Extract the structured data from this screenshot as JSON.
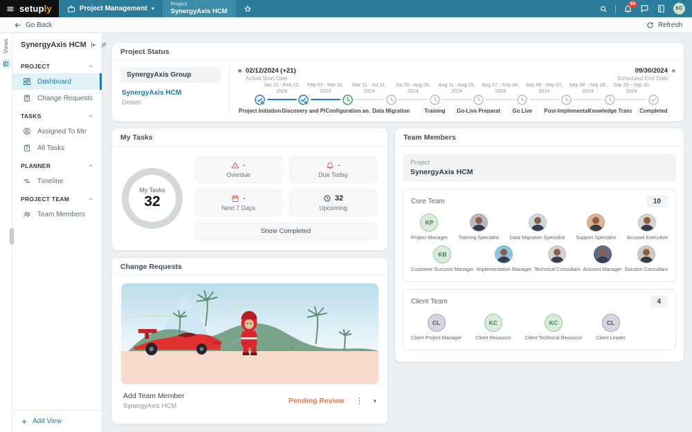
{
  "colors": {
    "topbar": "#2b7d9b",
    "accent_teal": "#1b7a9e",
    "done_blue": "#1873cc",
    "active_green": "#3da04a",
    "alert_red": "#d9534f",
    "pending_orange": "#d97c4e",
    "logo_accent": "#f0a23c",
    "badge_red": "#e2483d"
  },
  "topbar": {
    "logo_first": "setup",
    "logo_second": "ly",
    "menu": "Project Management",
    "tab_type": "Project",
    "tab_name": "SynergyAxis HCM",
    "notification_count": "64",
    "user_initials": "KC"
  },
  "toolbar": {
    "back": "Go Back",
    "refresh": "Refresh"
  },
  "views_rail": {
    "label": "Views"
  },
  "sidebar": {
    "title": "SynergyAxis HCM",
    "add_view": "Add View",
    "sections": [
      {
        "label": "PROJECT",
        "items": [
          {
            "label": "Dashboard",
            "icon": "dashboard-grid",
            "active": true
          },
          {
            "label": "Change Requests",
            "icon": "change-request-clipboard",
            "active": false
          }
        ]
      },
      {
        "label": "TASKS",
        "items": [
          {
            "label": "Assigned To Me",
            "icon": "user-circle",
            "active": false
          },
          {
            "label": "All Tasks",
            "icon": "task-clipboard",
            "active": false
          }
        ]
      },
      {
        "label": "PLANNER",
        "items": [
          {
            "label": "Timeline",
            "icon": "timeline-bars",
            "active": false
          }
        ]
      },
      {
        "label": "PROJECT TEAM",
        "items": [
          {
            "label": "Team Members",
            "icon": "people",
            "active": false
          }
        ]
      }
    ]
  },
  "project_status": {
    "title": "Project Status",
    "group": "SynergyAxis Group",
    "project": "SynergyAxis HCM",
    "details": "Details",
    "actual_start": {
      "date": "02/12/2024 (+21)",
      "label": "Actual Start Date"
    },
    "scheduled_end": {
      "date": "09/30/2024",
      "label": "Scheduled End Date"
    },
    "phases": [
      {
        "dates": "Jan 22 - Feb 12, 2024",
        "name": "Project Initiation",
        "status": "done"
      },
      {
        "dates": "Feb 03 - Mar 11, 2024",
        "name": "Discovery and Pla...",
        "status": "done"
      },
      {
        "dates": "Mar 11 - Jul 31, 2024",
        "name": "Configuration an...",
        "status": "active"
      },
      {
        "dates": "Jul 29 - Aug 09, 2024",
        "name": "Data Migration",
        "status": "pending"
      },
      {
        "dates": "Aug 11 - Aug 25, 2024",
        "name": "Training",
        "status": "pending"
      },
      {
        "dates": "Aug 27 - Sep 04, 2024",
        "name": "Go-Live Preparati...",
        "status": "pending"
      },
      {
        "dates": "Sep 06 - Sep 07, 2024",
        "name": "Go Live",
        "status": "pending"
      },
      {
        "dates": "Sep 08 - Sep 28, 2024",
        "name": "Post-Implementa...",
        "status": "pending"
      },
      {
        "dates": "Sep 29 - Sep 30, 2024",
        "name": "Knowledge Transf...",
        "status": "pending"
      },
      {
        "dates": "",
        "name": "Completed",
        "status": "end"
      }
    ]
  },
  "my_tasks": {
    "title": "My Tasks",
    "ring_label": "My Tasks",
    "ring_value": "32",
    "stats": [
      {
        "label": "Overdue",
        "value": "-",
        "icon": "warning-triangle-icon",
        "tone": "red"
      },
      {
        "label": "Due Today",
        "value": "-",
        "icon": "bell-icon",
        "tone": "red"
      },
      {
        "label": "Next 7 Days",
        "value": "-",
        "icon": "calendar-icon",
        "tone": "red"
      },
      {
        "label": "Upcoming",
        "value": "32",
        "icon": "clock-icon",
        "tone": "dark"
      }
    ],
    "show_completed": "Show Completed"
  },
  "change_requests": {
    "title": "Change Requests",
    "item": {
      "title": "Add Team Member",
      "subtitle": "SynergyAxis HCM",
      "status": "Pending Review"
    }
  },
  "team_members": {
    "title": "Team Members",
    "project_label": "Project",
    "project_name": "SynergyAxis HCM",
    "core_team": {
      "label": "Core Team",
      "count": "10",
      "members": [
        {
          "type": "initials",
          "initials": "KP",
          "palette": "green",
          "role": "Project Manager"
        },
        {
          "type": "photo",
          "bg": "#b9b9bf",
          "role": "Training Specialist"
        },
        {
          "type": "photo",
          "bg": "#cfd8e2",
          "role": "Data Migration Specialist"
        },
        {
          "type": "photo",
          "bg": "#e0b18c",
          "role": "Support Specialist"
        },
        {
          "type": "photo",
          "bg": "#d8d3cf",
          "role": "Account Executive"
        },
        {
          "type": "initials",
          "initials": "KB",
          "palette": "green",
          "role": "Customer Success Manager"
        },
        {
          "type": "photo",
          "bg": "#8fc4e0",
          "role": "Implementation Manager"
        },
        {
          "type": "photo",
          "bg": "#d6d2cd",
          "role": "Technical Consultant"
        },
        {
          "type": "photo",
          "bg": "#5f6b80",
          "role": "Account Manager"
        },
        {
          "type": "photo",
          "bg": "#cfc9c2",
          "role": "Solution Consultant"
        }
      ]
    },
    "client_team": {
      "label": "Client Team",
      "count": "4",
      "members": [
        {
          "type": "initials",
          "initials": "CL",
          "palette": "purple",
          "role": "Client Project Manager"
        },
        {
          "type": "initials",
          "initials": "KC",
          "palette": "green",
          "role": "Client Resource"
        },
        {
          "type": "initials",
          "initials": "KC",
          "palette": "green",
          "role": "Client Technical Resource"
        },
        {
          "type": "initials",
          "initials": "CL",
          "palette": "purple",
          "role": "Client Leader"
        }
      ]
    }
  }
}
